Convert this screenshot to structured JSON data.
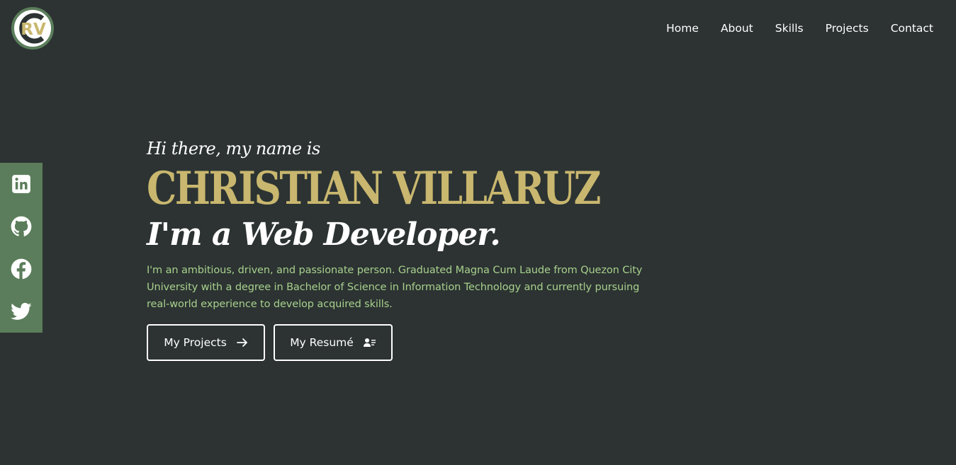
{
  "logo": {
    "text": "RV",
    "icon": "cv-monogram-logo"
  },
  "nav": {
    "items": [
      "Home",
      "About",
      "Skills",
      "Projects",
      "Contact"
    ]
  },
  "social": [
    {
      "name": "linkedin-icon"
    },
    {
      "name": "github-icon"
    },
    {
      "name": "facebook-icon"
    },
    {
      "name": "twitter-icon"
    }
  ],
  "hero": {
    "greeting": "Hi there, my name is",
    "name": "CHRISTIAN VILLARUZ",
    "role": "I'm a Web Developer.",
    "bio": "I'm an ambitious, driven, and passionate person. Graduated Magna Cum Laude from Quezon City University with a degree in Bachelor of Science in Information Technology and currently pursuing real-world experience to develop acquired skills."
  },
  "buttons": {
    "projects": {
      "label": "My Projects",
      "icon": "arrow-right-icon"
    },
    "resume": {
      "label": "My Resumé",
      "icon": "resume-icon"
    }
  },
  "colors": {
    "background": "#2c3332",
    "accent_gold": "#c9b76f",
    "accent_green": "#a8d08d",
    "sidebar": "#5b7d5b"
  }
}
